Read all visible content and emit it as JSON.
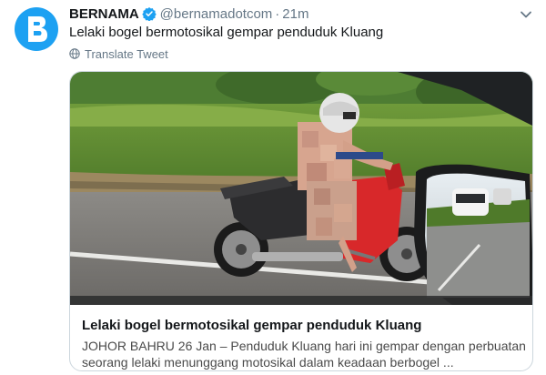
{
  "tweet": {
    "author_name": "BERNAMA",
    "handle": "@bernamadotcom",
    "separator": "·",
    "time_ago": "21m",
    "text": "Lelaki bogel bermotosikal gempar penduduk Kluang",
    "translate_label": "Translate Tweet"
  },
  "card": {
    "title": "Lelaki bogel bermotosikal gempar penduduk Kluang",
    "description": "JOHOR BAHRU 26 Jan – Penduduk Kluang hari ini gempar dengan perbuatan seorang lelaki menunggang motosikal dalam keadaan berbogel ..."
  },
  "colors": {
    "brand_blue": "#1da1f2",
    "verified_blue": "#1da1f2",
    "secondary_text": "#657786",
    "motorcycle_red": "#d8282a"
  },
  "icons": {
    "avatar_logo": "bernama-logo-icon",
    "verified": "verified-badge-icon",
    "more": "chevron-down-icon",
    "translate": "globe-icon"
  }
}
